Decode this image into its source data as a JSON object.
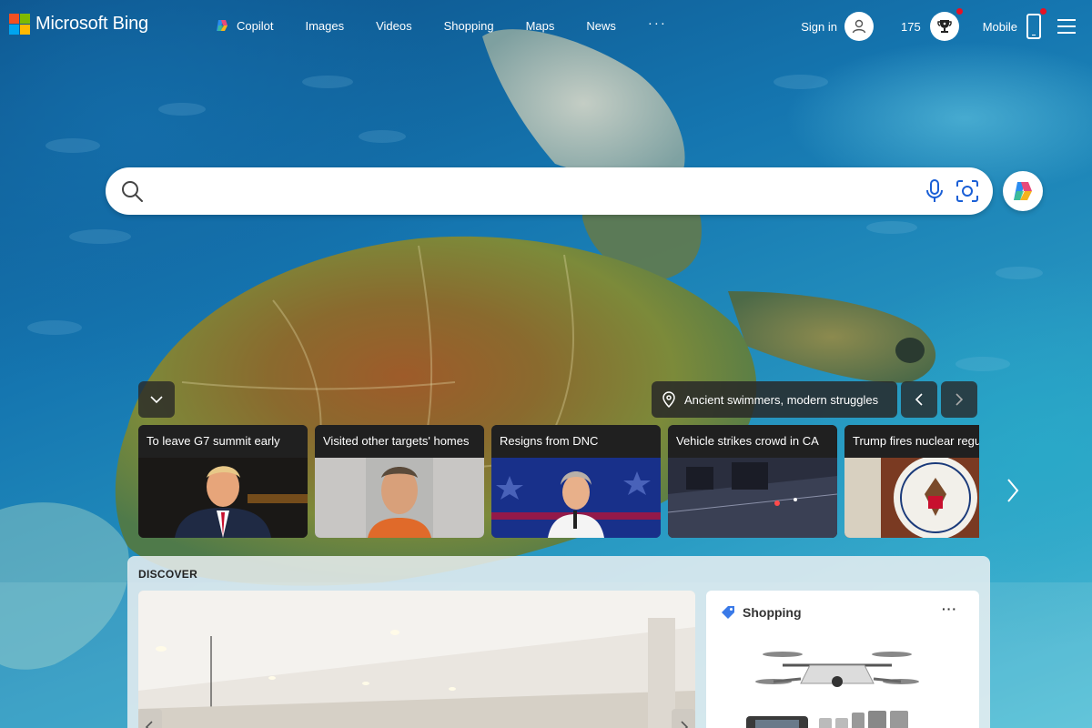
{
  "header": {
    "logo_text": "Microsoft Bing",
    "nav": [
      {
        "label": "Copilot"
      },
      {
        "label": "Images"
      },
      {
        "label": "Videos"
      },
      {
        "label": "Shopping"
      },
      {
        "label": "Maps"
      },
      {
        "label": "News"
      }
    ],
    "more": "···",
    "sign_in": "Sign in",
    "rewards_points": "175",
    "mobile": "Mobile"
  },
  "search": {
    "value": "",
    "placeholder": ""
  },
  "carousel": {
    "location_caption": "Ancient swimmers, modern struggles",
    "cards": [
      {
        "title": "To leave G7 summit early"
      },
      {
        "title": "Visited other targets' homes"
      },
      {
        "title": "Resigns from DNC"
      },
      {
        "title": "Vehicle strikes crowd in CA"
      },
      {
        "title": "Trump fires nuclear regulator"
      }
    ]
  },
  "discover": {
    "title": "DISCOVER",
    "shopping_title": "Shopping",
    "shopping_more": "···"
  },
  "colors": {
    "accent_red": "#e81123",
    "card_bar": "#1e1e1e",
    "search_bg": "#ffffff"
  }
}
